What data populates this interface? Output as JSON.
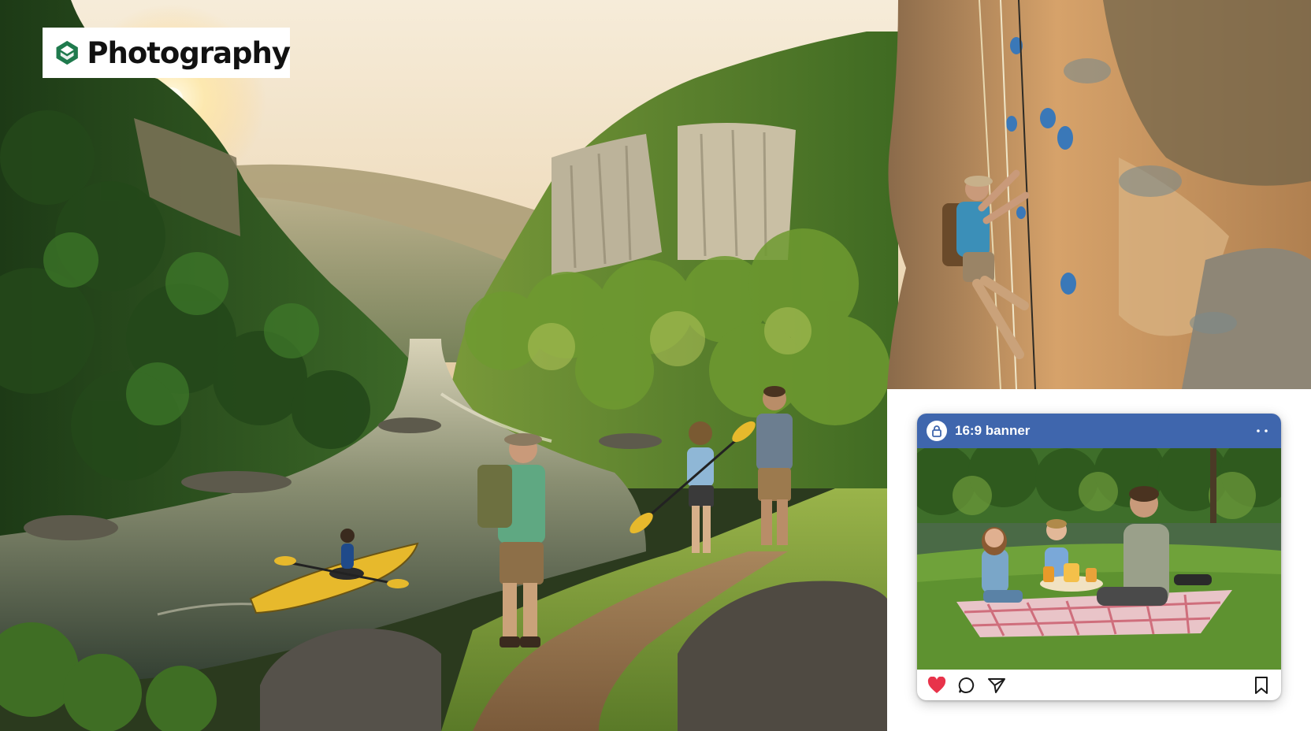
{
  "brand": {
    "name": "Photography",
    "mark_colors": [
      "#1f7a4d",
      "#145c38"
    ]
  },
  "post": {
    "title": "16:9 banner",
    "header_color": "#3f66ad",
    "actions": {
      "like_icon": "heart-icon",
      "comment_icon": "comment-icon",
      "share_icon": "send-icon",
      "save_icon": "bookmark-icon",
      "like_color": "#e8334a"
    },
    "menu_icon": "more-icon",
    "lock_icon": "lock-icon"
  },
  "scene": {
    "sky_colors": [
      "#f3e6cf",
      "#e9d6b6"
    ],
    "forest_color": "#2f5a22",
    "river_color": "#3a4a3a",
    "cliff_color": "#c49262"
  }
}
